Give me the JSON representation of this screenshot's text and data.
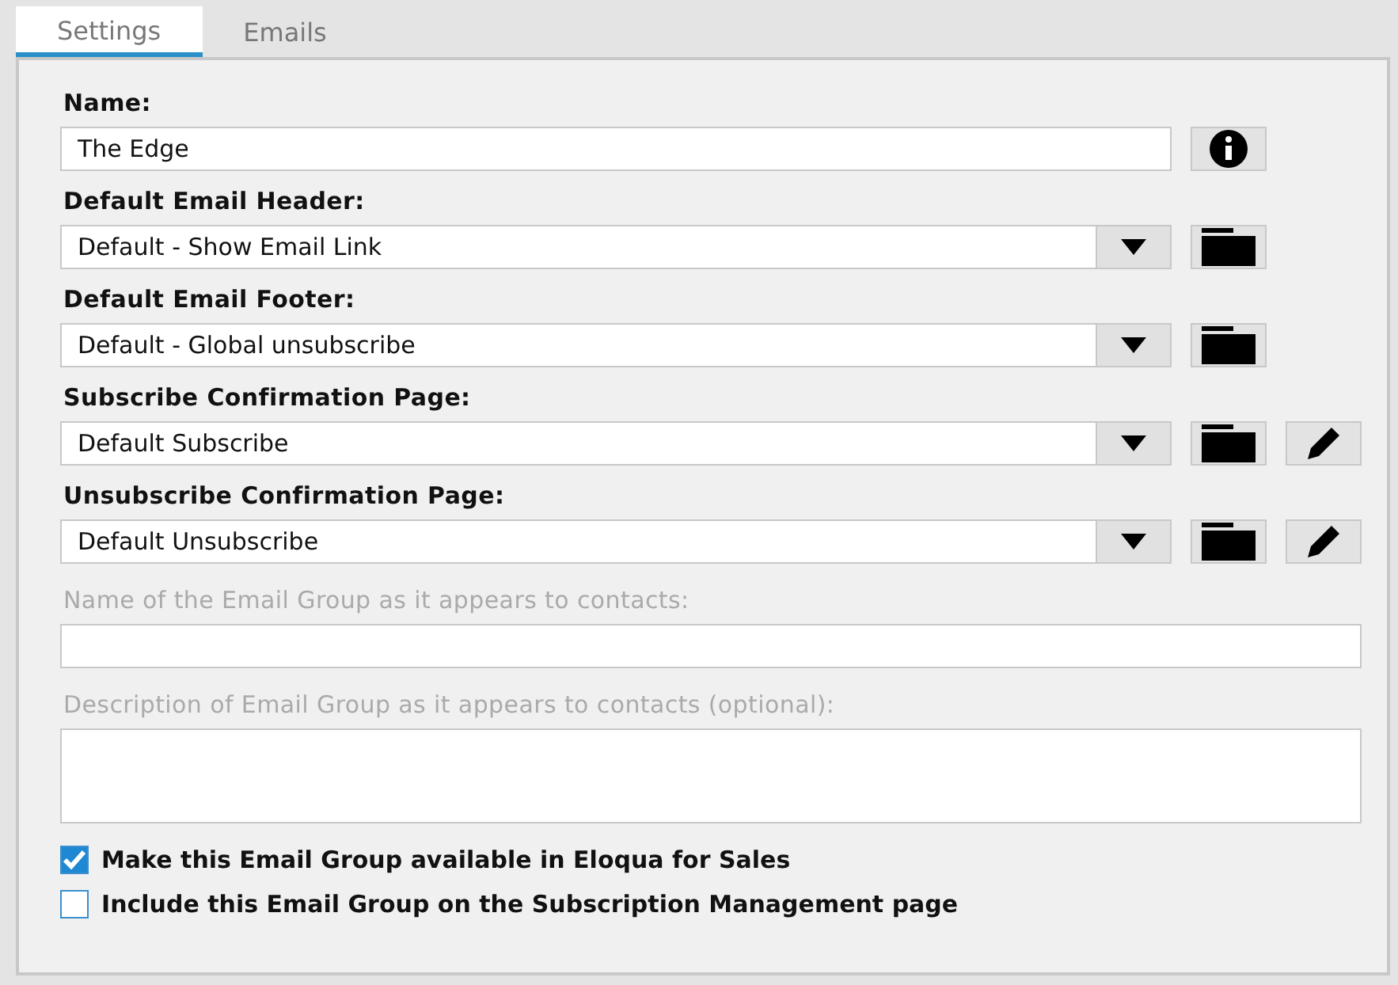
{
  "tabs": [
    {
      "label": "Settings",
      "selected": true
    },
    {
      "label": "Emails",
      "selected": false
    }
  ],
  "fields": [
    {
      "kind": "text",
      "label": "Name:",
      "value": "The Edge",
      "disabled": false,
      "buttons": [
        {
          "kind": "info"
        }
      ]
    },
    {
      "kind": "select",
      "label": "Default Email Header:",
      "value": "Default - Show Email Link",
      "disabled": false,
      "buttons": [
        {
          "kind": "folder"
        }
      ]
    },
    {
      "kind": "select",
      "label": "Default Email Footer:",
      "value": "Default - Global unsubscribe",
      "disabled": false,
      "buttons": [
        {
          "kind": "folder"
        }
      ]
    },
    {
      "kind": "select",
      "label": "Subscribe Confirmation Page:",
      "value": "Default Subscribe",
      "disabled": false,
      "buttons": [
        {
          "kind": "folder"
        },
        {
          "kind": "edit"
        }
      ]
    },
    {
      "kind": "select",
      "label": "Unsubscribe Confirmation Page:",
      "value": "Default Unsubscribe",
      "disabled": false,
      "buttons": [
        {
          "kind": "folder"
        },
        {
          "kind": "edit"
        }
      ]
    },
    {
      "kind": "text",
      "label": "Name of the Email Group as it appears to contacts:",
      "disabled": true
    },
    {
      "kind": "textarea",
      "label": "Description of Email Group as it appears to contacts (optional):",
      "disabled": true
    }
  ],
  "checkboxes": [
    {
      "label": "Make this Email Group available in Eloqua for Sales",
      "checked": true
    },
    {
      "label": "Include this Email Group on the Subscription Management page",
      "checked": false
    }
  ]
}
